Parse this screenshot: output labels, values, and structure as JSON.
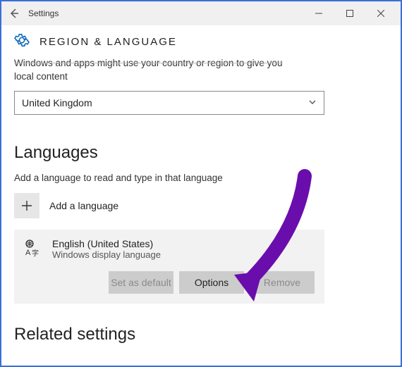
{
  "window": {
    "title": "Settings"
  },
  "header": {
    "title": "REGION & LANGUAGE"
  },
  "region": {
    "description_line1": "Windows and apps might use your country or region to give you",
    "description_line2": "local content",
    "selected": "United Kingdom"
  },
  "languages": {
    "heading": "Languages",
    "subtext": "Add a language to read and type in that language",
    "add_label": "Add a language",
    "item": {
      "name": "English (United States)",
      "sub": "Windows display language"
    },
    "buttons": {
      "set_default": "Set as default",
      "options": "Options",
      "remove": "Remove"
    }
  },
  "related": {
    "heading": "Related settings"
  }
}
